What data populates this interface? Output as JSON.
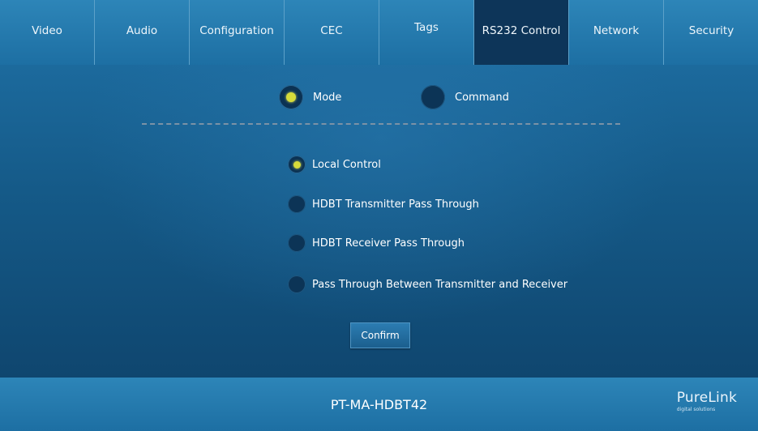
{
  "nav": {
    "tabs": [
      {
        "label": "Video"
      },
      {
        "label": "Audio"
      },
      {
        "label": "Configuration"
      },
      {
        "label": "CEC"
      },
      {
        "label": "Tags"
      },
      {
        "label": "RS232 Control"
      },
      {
        "label": "Network"
      },
      {
        "label": "Security"
      }
    ],
    "active_tab": "RS232 Control"
  },
  "mode_selector": {
    "options": [
      {
        "label": "Mode",
        "selected": true
      },
      {
        "label": "Command",
        "selected": false
      }
    ]
  },
  "control_options": [
    {
      "label": "Local Control",
      "selected": true
    },
    {
      "label": "HDBT Transmitter Pass Through",
      "selected": false
    },
    {
      "label": "HDBT Receiver Pass Through",
      "selected": false
    },
    {
      "label": "Pass Through Between Transmitter and Receiver",
      "selected": false
    }
  ],
  "confirm_label": "Confirm",
  "footer": {
    "device_name": "PT-MA-HDBT42",
    "logo_brand": "PureLink",
    "logo_tagline": "digital solutions"
  },
  "colors": {
    "nav_bg": "#1d6fa3",
    "active_tab_bg": "#0d3559",
    "radio_selected": "#d6db3a",
    "main_bg": "#155a88"
  }
}
